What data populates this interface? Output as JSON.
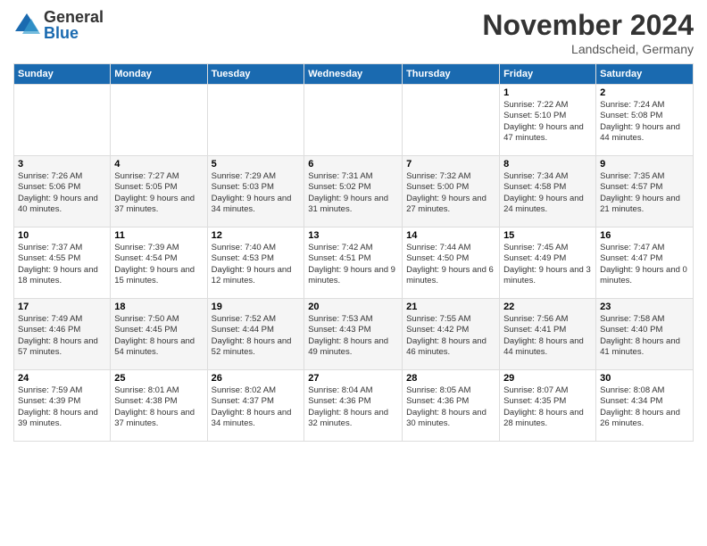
{
  "logo": {
    "general": "General",
    "blue": "Blue"
  },
  "title": "November 2024",
  "location": "Landscheid, Germany",
  "days_of_week": [
    "Sunday",
    "Monday",
    "Tuesday",
    "Wednesday",
    "Thursday",
    "Friday",
    "Saturday"
  ],
  "weeks": [
    {
      "days": [
        {
          "num": "",
          "info": ""
        },
        {
          "num": "",
          "info": ""
        },
        {
          "num": "",
          "info": ""
        },
        {
          "num": "",
          "info": ""
        },
        {
          "num": "",
          "info": ""
        },
        {
          "num": "1",
          "info": "Sunrise: 7:22 AM\nSunset: 5:10 PM\nDaylight: 9 hours and 47 minutes."
        },
        {
          "num": "2",
          "info": "Sunrise: 7:24 AM\nSunset: 5:08 PM\nDaylight: 9 hours and 44 minutes."
        }
      ]
    },
    {
      "days": [
        {
          "num": "3",
          "info": "Sunrise: 7:26 AM\nSunset: 5:06 PM\nDaylight: 9 hours and 40 minutes."
        },
        {
          "num": "4",
          "info": "Sunrise: 7:27 AM\nSunset: 5:05 PM\nDaylight: 9 hours and 37 minutes."
        },
        {
          "num": "5",
          "info": "Sunrise: 7:29 AM\nSunset: 5:03 PM\nDaylight: 9 hours and 34 minutes."
        },
        {
          "num": "6",
          "info": "Sunrise: 7:31 AM\nSunset: 5:02 PM\nDaylight: 9 hours and 31 minutes."
        },
        {
          "num": "7",
          "info": "Sunrise: 7:32 AM\nSunset: 5:00 PM\nDaylight: 9 hours and 27 minutes."
        },
        {
          "num": "8",
          "info": "Sunrise: 7:34 AM\nSunset: 4:58 PM\nDaylight: 9 hours and 24 minutes."
        },
        {
          "num": "9",
          "info": "Sunrise: 7:35 AM\nSunset: 4:57 PM\nDaylight: 9 hours and 21 minutes."
        }
      ]
    },
    {
      "days": [
        {
          "num": "10",
          "info": "Sunrise: 7:37 AM\nSunset: 4:55 PM\nDaylight: 9 hours and 18 minutes."
        },
        {
          "num": "11",
          "info": "Sunrise: 7:39 AM\nSunset: 4:54 PM\nDaylight: 9 hours and 15 minutes."
        },
        {
          "num": "12",
          "info": "Sunrise: 7:40 AM\nSunset: 4:53 PM\nDaylight: 9 hours and 12 minutes."
        },
        {
          "num": "13",
          "info": "Sunrise: 7:42 AM\nSunset: 4:51 PM\nDaylight: 9 hours and 9 minutes."
        },
        {
          "num": "14",
          "info": "Sunrise: 7:44 AM\nSunset: 4:50 PM\nDaylight: 9 hours and 6 minutes."
        },
        {
          "num": "15",
          "info": "Sunrise: 7:45 AM\nSunset: 4:49 PM\nDaylight: 9 hours and 3 minutes."
        },
        {
          "num": "16",
          "info": "Sunrise: 7:47 AM\nSunset: 4:47 PM\nDaylight: 9 hours and 0 minutes."
        }
      ]
    },
    {
      "days": [
        {
          "num": "17",
          "info": "Sunrise: 7:49 AM\nSunset: 4:46 PM\nDaylight: 8 hours and 57 minutes."
        },
        {
          "num": "18",
          "info": "Sunrise: 7:50 AM\nSunset: 4:45 PM\nDaylight: 8 hours and 54 minutes."
        },
        {
          "num": "19",
          "info": "Sunrise: 7:52 AM\nSunset: 4:44 PM\nDaylight: 8 hours and 52 minutes."
        },
        {
          "num": "20",
          "info": "Sunrise: 7:53 AM\nSunset: 4:43 PM\nDaylight: 8 hours and 49 minutes."
        },
        {
          "num": "21",
          "info": "Sunrise: 7:55 AM\nSunset: 4:42 PM\nDaylight: 8 hours and 46 minutes."
        },
        {
          "num": "22",
          "info": "Sunrise: 7:56 AM\nSunset: 4:41 PM\nDaylight: 8 hours and 44 minutes."
        },
        {
          "num": "23",
          "info": "Sunrise: 7:58 AM\nSunset: 4:40 PM\nDaylight: 8 hours and 41 minutes."
        }
      ]
    },
    {
      "days": [
        {
          "num": "24",
          "info": "Sunrise: 7:59 AM\nSunset: 4:39 PM\nDaylight: 8 hours and 39 minutes."
        },
        {
          "num": "25",
          "info": "Sunrise: 8:01 AM\nSunset: 4:38 PM\nDaylight: 8 hours and 37 minutes."
        },
        {
          "num": "26",
          "info": "Sunrise: 8:02 AM\nSunset: 4:37 PM\nDaylight: 8 hours and 34 minutes."
        },
        {
          "num": "27",
          "info": "Sunrise: 8:04 AM\nSunset: 4:36 PM\nDaylight: 8 hours and 32 minutes."
        },
        {
          "num": "28",
          "info": "Sunrise: 8:05 AM\nSunset: 4:36 PM\nDaylight: 8 hours and 30 minutes."
        },
        {
          "num": "29",
          "info": "Sunrise: 8:07 AM\nSunset: 4:35 PM\nDaylight: 8 hours and 28 minutes."
        },
        {
          "num": "30",
          "info": "Sunrise: 8:08 AM\nSunset: 4:34 PM\nDaylight: 8 hours and 26 minutes."
        }
      ]
    }
  ]
}
